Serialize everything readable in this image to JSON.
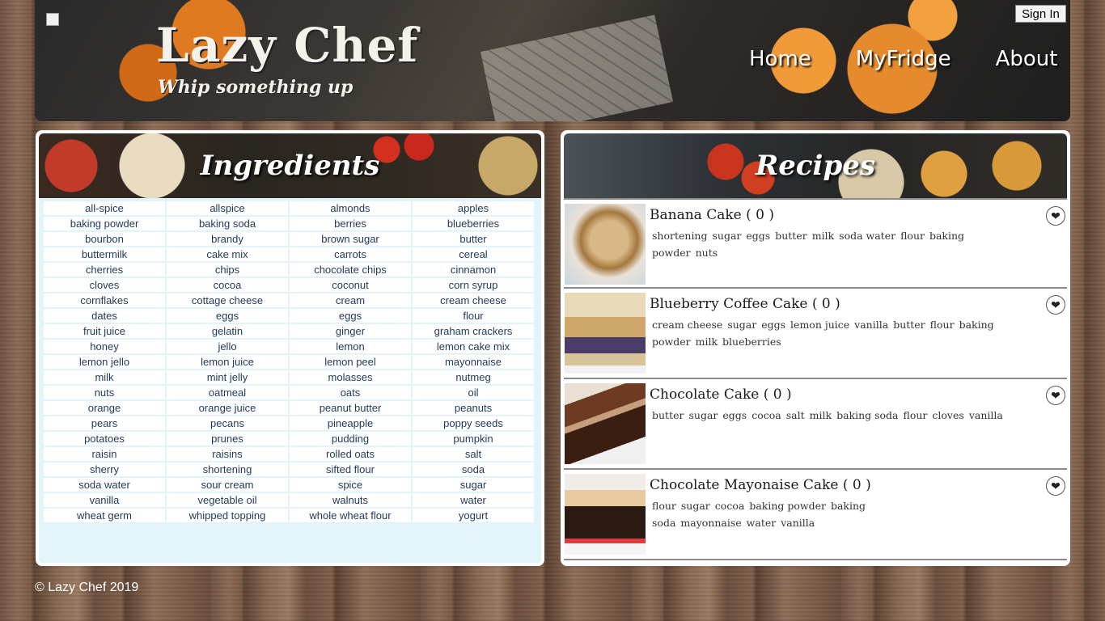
{
  "header": {
    "title": "Lazy Chef",
    "tagline": "Whip something up",
    "signin_label": "Sign In",
    "nav": {
      "home": "Home",
      "fridge": "MyFridge",
      "about": "About"
    }
  },
  "ingredients": {
    "title": "Ingredients",
    "items": [
      "all-spice",
      "allspice",
      "almonds",
      "apples",
      "baking powder",
      "baking soda",
      "berries",
      "blueberries",
      "bourbon",
      "brandy",
      "brown sugar",
      "butter",
      "buttermilk",
      "cake mix",
      "carrots",
      "cereal",
      "cherries",
      "chips",
      "chocolate chips",
      "cinnamon",
      "cloves",
      "cocoa",
      "coconut",
      "corn syrup",
      "cornflakes",
      "cottage cheese",
      "cream",
      "cream cheese",
      "dates",
      "eggs",
      "eggs",
      "flour",
      "fruit juice",
      "gelatin",
      "ginger",
      "graham crackers",
      "honey",
      "jello",
      "lemon",
      "lemon cake mix",
      "lemon jello",
      "lemon juice",
      "lemon peel",
      "mayonnaise",
      "milk",
      "mint jelly",
      "molasses",
      "nutmeg",
      "nuts",
      "oatmeal",
      "oats",
      "oil",
      "orange",
      "orange juice",
      "peanut butter",
      "peanuts",
      "pears",
      "pecans",
      "pineapple",
      "poppy seeds",
      "potatoes",
      "prunes",
      "pudding",
      "pumpkin",
      "raisin",
      "raisins",
      "rolled oats",
      "salt",
      "sherry",
      "shortening",
      "sifted flour",
      "soda",
      "soda water",
      "sour cream",
      "spice",
      "sugar",
      "vanilla",
      "vegetable oil",
      "walnuts",
      "water",
      "wheat germ",
      "whipped topping",
      "whole wheat flour",
      "yogurt"
    ]
  },
  "recipes": {
    "title": "Recipes",
    "items": [
      {
        "name": "Banana Cake ( 0 )",
        "ingredients": [
          "shortening",
          "sugar",
          "eggs",
          "butter",
          "milk",
          "soda water",
          "flour",
          "baking powder",
          "nuts"
        ]
      },
      {
        "name": "Blueberry Coffee Cake ( 0 )",
        "ingredients": [
          "cream cheese",
          "sugar",
          "eggs",
          "lemon juice",
          "vanilla",
          "butter",
          "flour",
          "baking powder",
          "milk",
          "blueberries"
        ]
      },
      {
        "name": "Chocolate Cake ( 0 )",
        "ingredients": [
          "butter",
          "sugar",
          "eggs",
          "cocoa",
          "salt",
          "milk",
          "baking soda",
          "flour",
          "cloves",
          "vanilla"
        ]
      },
      {
        "name": "Chocolate Mayonaise Cake ( 0 )",
        "ingredients": [
          "flour",
          "sugar",
          "cocoa",
          "baking powder",
          "baking soda",
          "mayonnaise",
          "water",
          "vanilla"
        ]
      }
    ]
  },
  "footer": {
    "text": "© Lazy Chef 2019"
  },
  "icons": {
    "favorite": "heart-icon",
    "broken_image": "broken-image-icon"
  }
}
